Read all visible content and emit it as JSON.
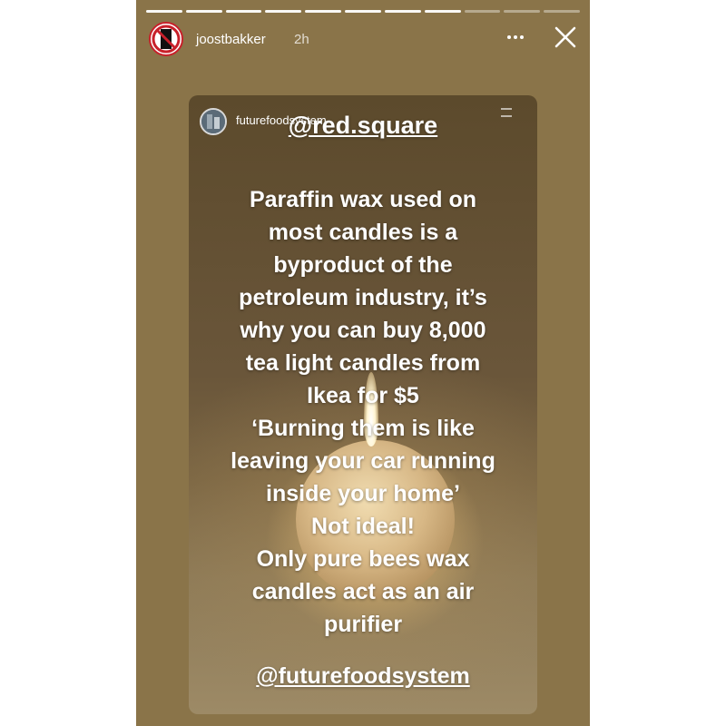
{
  "story": {
    "progress": {
      "total_segments": 11,
      "completed_segments": 8
    },
    "header": {
      "username": "joostbakker",
      "time": "2h",
      "avatar_icon": "no-sign-icon",
      "more_icon": "more-horizontal-icon",
      "close_icon": "close-icon"
    },
    "shared_post": {
      "source_username": "futurefoodsystem",
      "mention_top": "@red.square",
      "body_lines": [
        "Paraffin wax used on",
        "most candles is a",
        "byproduct of the",
        "petroleum industry, it’s",
        "why you can buy 8,000",
        "tea light candles from",
        "Ikea for $5",
        "‘Burning them is like",
        "leaving your car running",
        "inside your home’",
        "Not ideal!",
        "Only pure bees wax",
        "candles act as an air",
        "purifier"
      ],
      "mention_bottom": "@futurefoodsystem"
    }
  },
  "colors": {
    "story_background": "#8a7449",
    "avatar_ring": "#c8202a",
    "text": "#ffffff"
  }
}
